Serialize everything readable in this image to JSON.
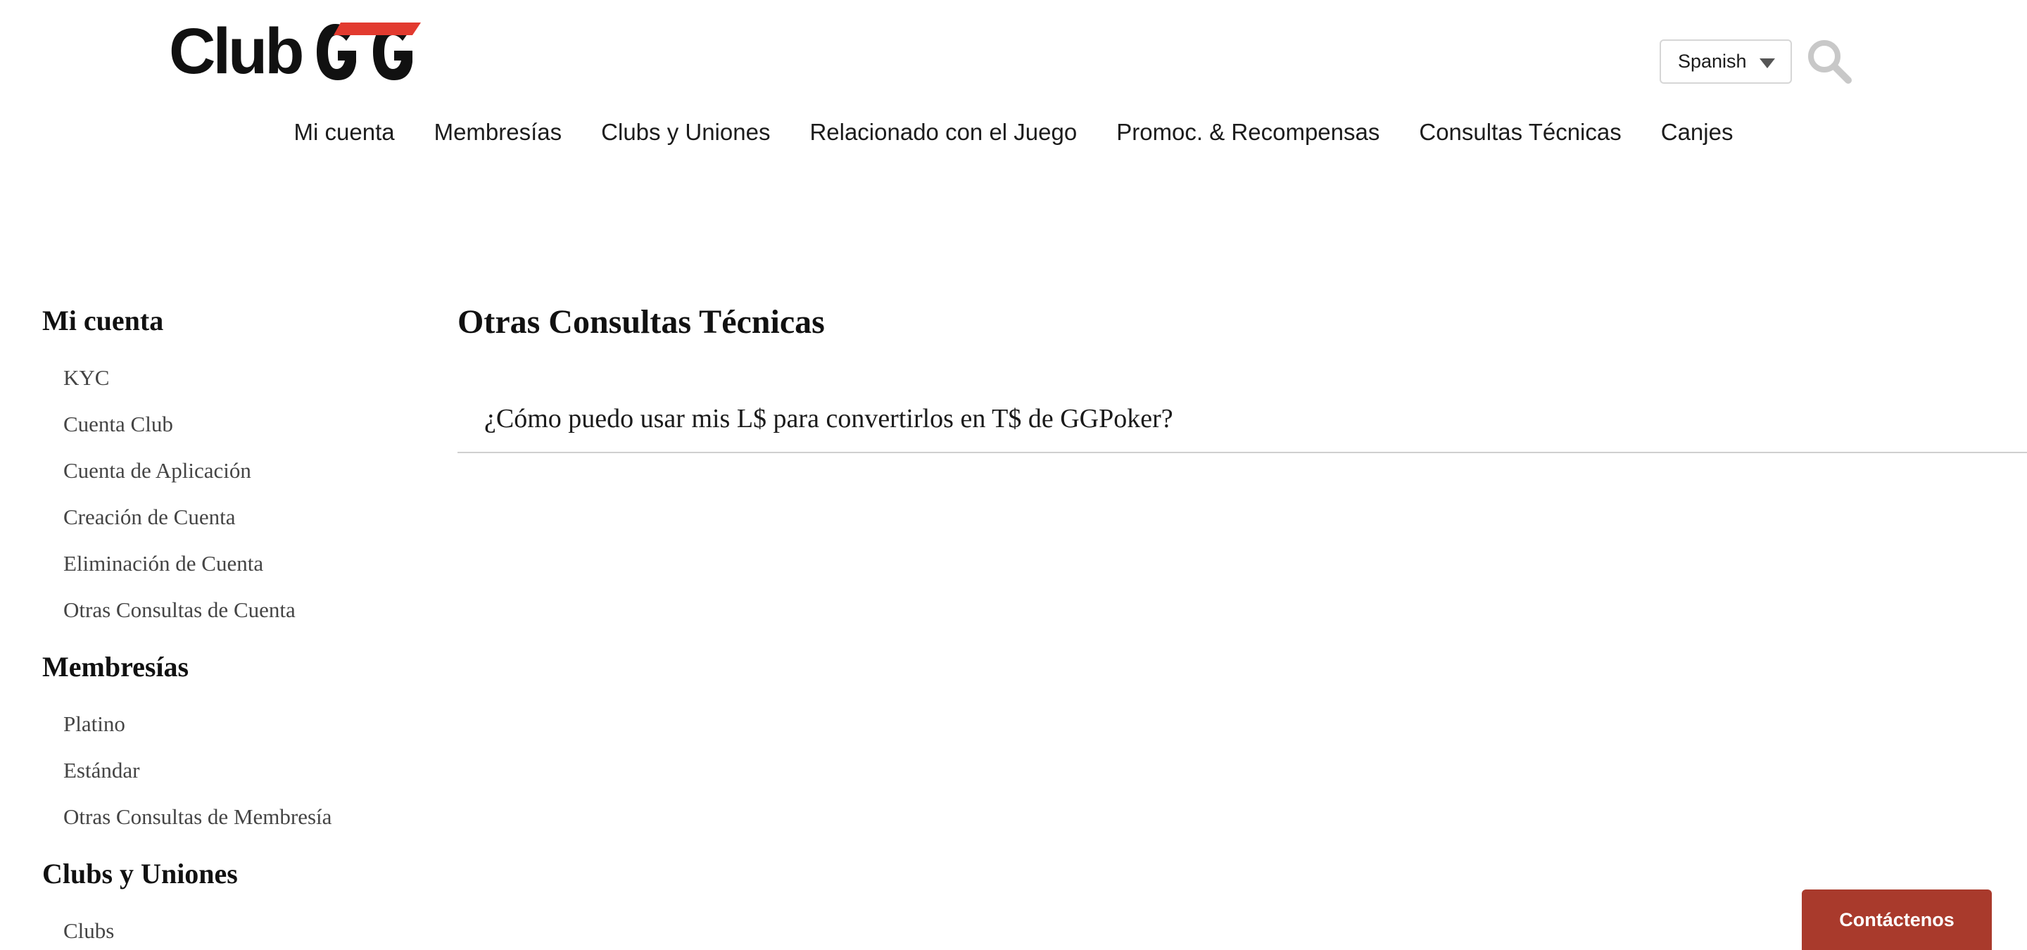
{
  "header": {
    "logo_text": "ClubGG",
    "language": "Spanish",
    "search_icon": "search-icon",
    "colors": {
      "logo_dark": "#111111",
      "logo_red": "#e23a2f",
      "icon_gray": "#c8c8c8"
    }
  },
  "nav": {
    "items": [
      {
        "label": "Mi cuenta"
      },
      {
        "label": "Membresías"
      },
      {
        "label": "Clubs y Uniones"
      },
      {
        "label": "Relacionado con el Juego"
      },
      {
        "label": "Promoc. & Recompensas"
      },
      {
        "label": "Consultas Técnicas"
      },
      {
        "label": "Canjes"
      }
    ]
  },
  "sidebar": {
    "sections": [
      {
        "title": "Mi cuenta",
        "links": [
          "KYC",
          "Cuenta Club",
          "Cuenta de Aplicación",
          "Creación de Cuenta",
          "Eliminación de Cuenta",
          "Otras Consultas de Cuenta"
        ]
      },
      {
        "title": "Membresías",
        "links": [
          "Platino",
          "Estándar",
          "Otras Consultas de Membresía"
        ]
      },
      {
        "title": "Clubs y Uniones",
        "links": [
          "Clubs"
        ]
      }
    ]
  },
  "main": {
    "title": "Otras Consultas Técnicas",
    "articles": [
      {
        "title": "¿Cómo puedo usar mis L$ para convertirlos en T$ de GGPoker?"
      }
    ]
  },
  "contact": {
    "label": "Contáctenos",
    "color": "#a93a2c"
  }
}
